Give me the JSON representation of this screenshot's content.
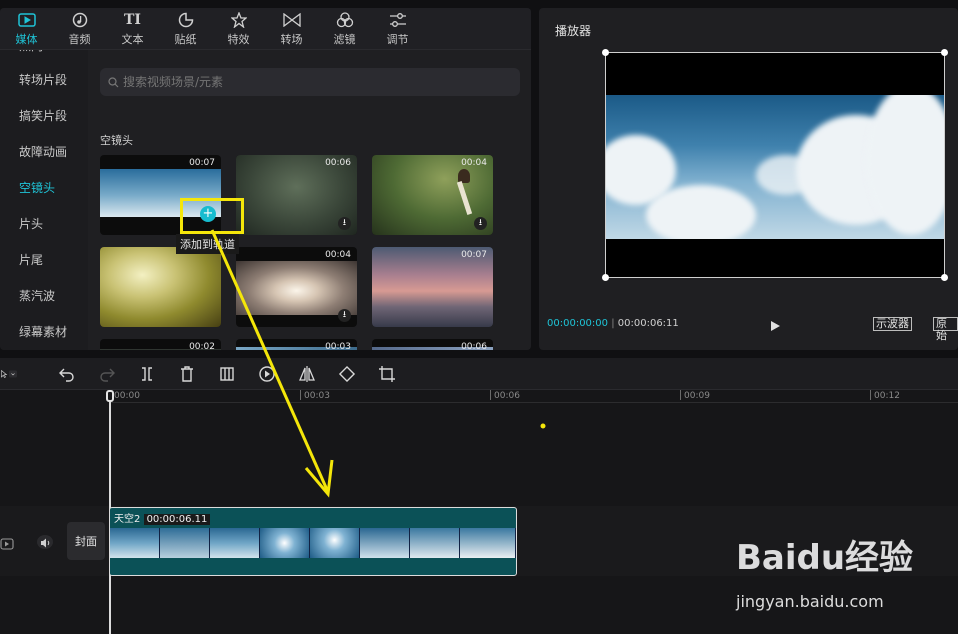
{
  "top_tabs": [
    {
      "label": "媒体",
      "icon": "media-icon",
      "active": true
    },
    {
      "label": "音频",
      "icon": "audio-icon",
      "active": false
    },
    {
      "label": "文本",
      "icon": "text-icon",
      "active": false
    },
    {
      "label": "贴纸",
      "icon": "sticker-icon",
      "active": false
    },
    {
      "label": "特效",
      "icon": "effects-icon",
      "active": false
    },
    {
      "label": "转场",
      "icon": "transition-icon",
      "active": false
    },
    {
      "label": "滤镜",
      "icon": "filter-icon",
      "active": false
    },
    {
      "label": "调节",
      "icon": "adjust-icon",
      "active": false
    }
  ],
  "sidebar": {
    "items": [
      {
        "label": "热门",
        "active": false
      },
      {
        "label": "转场片段",
        "active": false
      },
      {
        "label": "搞笑片段",
        "active": false
      },
      {
        "label": "故障动画",
        "active": false
      },
      {
        "label": "空镜头",
        "active": true
      },
      {
        "label": "片头",
        "active": false
      },
      {
        "label": "片尾",
        "active": false
      },
      {
        "label": "蒸汽波",
        "active": false
      },
      {
        "label": "绿幕素材",
        "active": false
      }
    ]
  },
  "search": {
    "placeholder": "搜索视频场景/元素"
  },
  "section_title": "空镜头",
  "thumbnails": [
    {
      "duration": "00:07",
      "scene": "sky"
    },
    {
      "duration": "00:06",
      "scene": "water"
    },
    {
      "duration": "00:04",
      "scene": "mushroom"
    },
    {
      "duration": "",
      "scene": "leaves"
    },
    {
      "duration": "00:04",
      "scene": "sun-branches"
    },
    {
      "duration": "00:07",
      "scene": "sunset-sea"
    },
    {
      "duration": "00:02",
      "scene": "dark"
    },
    {
      "duration": "00:03",
      "scene": "blue"
    },
    {
      "duration": "00:06",
      "scene": "dusk"
    }
  ],
  "add_tooltip": "添加到轨道",
  "player": {
    "title": "播放器",
    "current_time": "00:00:00:00",
    "total_time": "00:00:06:11",
    "oscilloscope_label": "示波器",
    "original_label": "原始"
  },
  "ruler": {
    "ticks": [
      "00:00",
      "00:03",
      "00:06",
      "00:09",
      "00:12"
    ]
  },
  "track": {
    "cover_label": "封面",
    "clip_name": "天空2",
    "clip_duration": "00:00:06.11"
  },
  "watermark": {
    "text": "Baidu经验",
    "url": "jingyan.baidu.com"
  },
  "colors": {
    "accent": "#1fc3d6",
    "callout": "#f4e60a",
    "clip": "#0b5157"
  }
}
